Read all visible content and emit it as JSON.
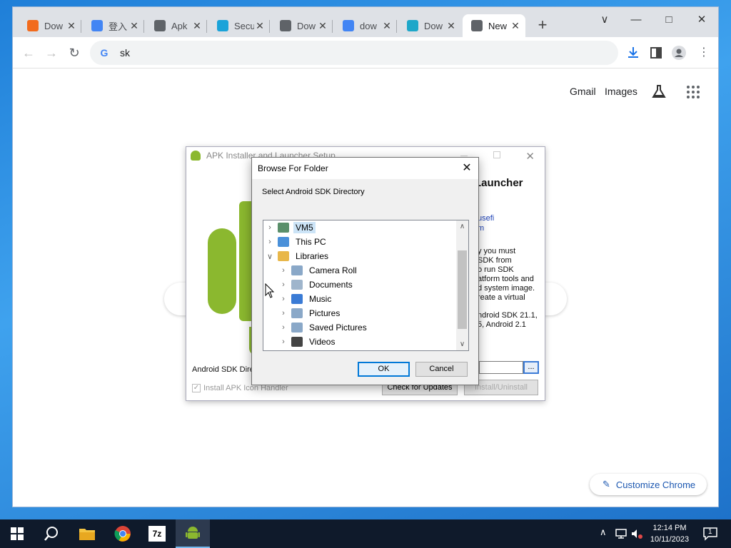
{
  "chrome": {
    "tabs": [
      {
        "title": "Dow",
        "favicon": "brave-shield-icon",
        "color": "#f26b1d"
      },
      {
        "title": "登入",
        "favicon": "google-g-icon",
        "color": "#4285f4"
      },
      {
        "title": "Apk",
        "favicon": "search-globe-icon",
        "color": "#5f6368"
      },
      {
        "title": "Secu",
        "favicon": "box-icon",
        "color": "#1aa3d9"
      },
      {
        "title": "Dow",
        "favicon": "globe-icon",
        "color": "#5f6368"
      },
      {
        "title": "dow",
        "favicon": "google-g-icon",
        "color": "#4285f4"
      },
      {
        "title": "Dow",
        "favicon": "down-arrow-logo-icon",
        "color": "#1ea7c9"
      },
      {
        "title": "New",
        "favicon": "chrome-icon",
        "color": "#5f6368"
      }
    ],
    "omnibox_text": "sk",
    "ntp_links": {
      "gmail": "Gmail",
      "images": "Images"
    },
    "customize_label": "Customize Chrome"
  },
  "setup": {
    "title": "APK Installer and Launcher Setup",
    "heading": "Launcher",
    "link1": "usefi",
    "link2": "m",
    "text_lines": [
      "y you must",
      "SDK from",
      "o run SDK",
      "atform tools and",
      "d system image.",
      "reate a virtual"
    ],
    "text2_lines": [
      "ndroid SDK 21.1,",
      "5, Android 2.1"
    ],
    "sdk_label": "Android SDK Directory:",
    "browse_label": "...",
    "check_label": "Install APK Icon Handler",
    "check_updates": "Check for Updates",
    "install_uninstall": "Install/Uninstall"
  },
  "browse": {
    "title": "Browse For Folder",
    "description": "Select Android SDK Directory",
    "tree": [
      {
        "label": "VM5",
        "icon": "user-icon",
        "level": 0,
        "expanded": false,
        "selected": true
      },
      {
        "label": "This PC",
        "icon": "computer-icon",
        "level": 0,
        "expanded": false
      },
      {
        "label": "Libraries",
        "icon": "libraries-icon",
        "level": 0,
        "expanded": true
      },
      {
        "label": "Camera Roll",
        "icon": "pictures-folder-icon",
        "level": 1,
        "expanded": false
      },
      {
        "label": "Documents",
        "icon": "documents-icon",
        "level": 1,
        "expanded": false
      },
      {
        "label": "Music",
        "icon": "music-icon",
        "level": 1,
        "expanded": false
      },
      {
        "label": "Pictures",
        "icon": "pictures-folder-icon",
        "level": 1,
        "expanded": false
      },
      {
        "label": "Saved Pictures",
        "icon": "pictures-folder-icon",
        "level": 1,
        "expanded": false
      },
      {
        "label": "Videos",
        "icon": "video-icon",
        "level": 1,
        "expanded": false
      }
    ],
    "ok_label": "OK",
    "cancel_label": "Cancel"
  },
  "taskbar": {
    "time": "12:14 PM",
    "date": "10/11/2023",
    "notification_count": "1"
  }
}
